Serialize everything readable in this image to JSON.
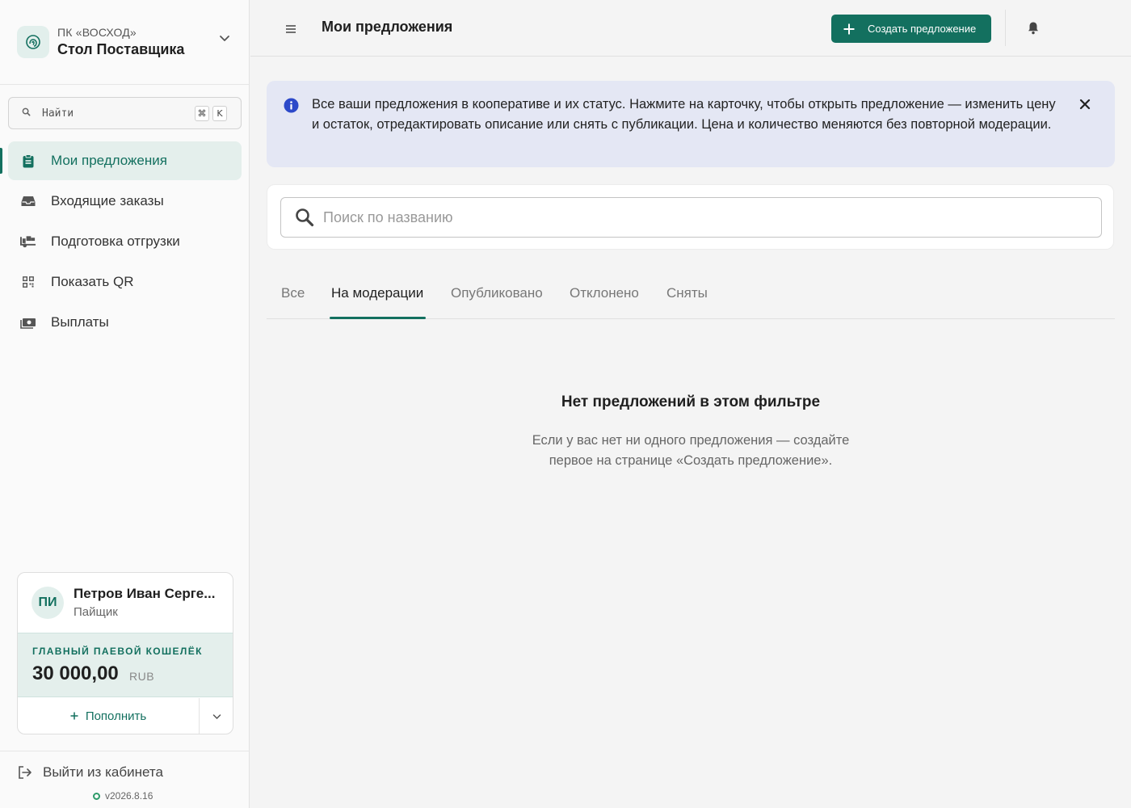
{
  "org": {
    "subtitle": "ПК «ВОСХОД»",
    "name": "Стол Поставщика"
  },
  "sidebar_search": {
    "label": "Найти",
    "shortcut_mod": "⌘",
    "shortcut_key": "K"
  },
  "nav": {
    "items": [
      {
        "label": "Мои предложения",
        "icon": "clipboard-icon",
        "active": true
      },
      {
        "label": "Входящие заказы",
        "icon": "inbox-icon",
        "active": false
      },
      {
        "label": "Подготовка отгрузки",
        "icon": "truck-loading-icon",
        "active": false
      },
      {
        "label": "Показать QR",
        "icon": "qr-code-icon",
        "active": false
      },
      {
        "label": "Выплаты",
        "icon": "money-icon",
        "active": false
      }
    ]
  },
  "user": {
    "initials": "ПИ",
    "name": "Петров Иван Серге...",
    "role": "Пайщик",
    "wallet_label": "ГЛАВНЫЙ ПАЕВОЙ КОШЕЛЁК",
    "wallet_amount": "30 000,00",
    "wallet_currency": "RUB",
    "topup_label": "Пополнить"
  },
  "logout_label": "Выйти из кабинета",
  "version": "v2026.8.16",
  "header": {
    "title": "Мои предложения",
    "create_label": "Создать предложение"
  },
  "info_banner": {
    "text": "Все ваши предложения в кооперативе и их статус. Нажмите на карточку, чтобы открыть предложение — изменить цену и остаток, отредактировать описание или снять с публикации. Цена и количество меняются без повторной модерации."
  },
  "search": {
    "placeholder": "Поиск по названию",
    "value": ""
  },
  "tabs": [
    {
      "label": "Все",
      "active": false
    },
    {
      "label": "На модерации",
      "active": true
    },
    {
      "label": "Опубликовано",
      "active": false
    },
    {
      "label": "Отклонено",
      "active": false
    },
    {
      "label": "Сняты",
      "active": false
    }
  ],
  "empty_state": {
    "title": "Нет предложений в этом фильтре",
    "description": "Если у вас нет ни одного предложения — создайте первое на странице «Создать предложение»."
  },
  "colors": {
    "accent": "#13705f",
    "accent_light": "#e4efec",
    "info_bg": "#e4e7f4",
    "info_icon": "#2c49c9"
  }
}
